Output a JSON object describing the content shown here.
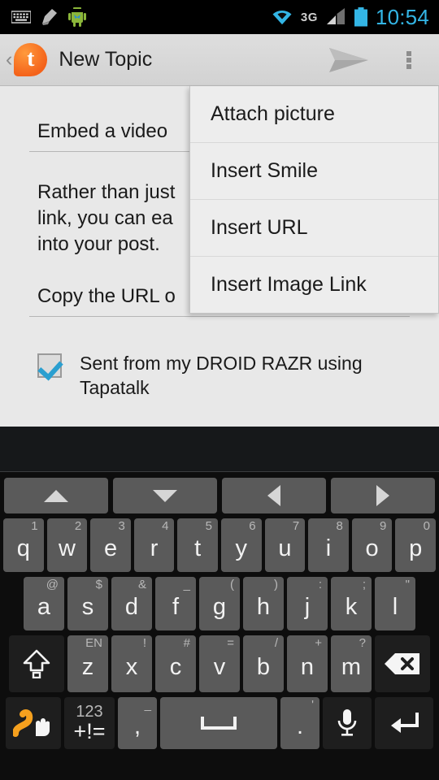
{
  "status_bar": {
    "icons": [
      "keyboard-icon",
      "broom-icon",
      "android-robot-icon"
    ],
    "wifi_icon": "wifi-icon",
    "network_label": "3G",
    "signal_icon": "signal-bars-icon",
    "battery_icon": "battery-icon",
    "clock": "10:54",
    "accent_color": "#33b5e5"
  },
  "action_bar": {
    "back_chevron": "‹",
    "logo_letter": "t",
    "logo_name": "tapatalk-logo-icon",
    "logo_color": "#f4621a",
    "title": "New Topic",
    "send_icon": "send-arrow-icon",
    "overflow_icon": "overflow-menu-icon"
  },
  "compose": {
    "title_value": "Embed a video",
    "body_lines": [
      "Rather than just",
      "link, you can ea",
      "into your post."
    ],
    "url_value": "Copy the URL o",
    "signature_label": "Sent from my DROID RAZR using Tapatalk",
    "signature_checked": true,
    "checkbox_color": "#2a9fd0"
  },
  "overflow_menu": {
    "items": [
      {
        "label": "Attach picture"
      },
      {
        "label": "Insert Smile"
      },
      {
        "label": "Insert URL"
      },
      {
        "label": "Insert Image Link"
      }
    ]
  },
  "keyboard": {
    "nav_keys": [
      {
        "name": "arrow-up-key",
        "icon": "triangle-up-icon"
      },
      {
        "name": "arrow-down-key",
        "icon": "triangle-down-icon"
      },
      {
        "name": "arrow-left-key",
        "icon": "triangle-left-icon"
      },
      {
        "name": "arrow-right-key",
        "icon": "triangle-right-icon"
      }
    ],
    "row1": [
      {
        "key": "q",
        "hint": "1"
      },
      {
        "key": "w",
        "hint": "2"
      },
      {
        "key": "e",
        "hint": "3"
      },
      {
        "key": "r",
        "hint": "4"
      },
      {
        "key": "t",
        "hint": "5"
      },
      {
        "key": "y",
        "hint": "6"
      },
      {
        "key": "u",
        "hint": "7"
      },
      {
        "key": "i",
        "hint": "8"
      },
      {
        "key": "o",
        "hint": "9"
      },
      {
        "key": "p",
        "hint": "0"
      }
    ],
    "row2": [
      {
        "key": "a",
        "hint": "@"
      },
      {
        "key": "s",
        "hint": "$"
      },
      {
        "key": "d",
        "hint": "&"
      },
      {
        "key": "f",
        "hint": "_"
      },
      {
        "key": "g",
        "hint": "("
      },
      {
        "key": "h",
        "hint": ")"
      },
      {
        "key": "j",
        "hint": ":"
      },
      {
        "key": "k",
        "hint": ";"
      },
      {
        "key": "l",
        "hint": "\""
      }
    ],
    "shift_key": {
      "name": "shift-key",
      "icon": "shift-arrow-icon"
    },
    "row3": [
      {
        "key": "z",
        "hint": "EN"
      },
      {
        "key": "x",
        "hint": "!"
      },
      {
        "key": "c",
        "hint": "#"
      },
      {
        "key": "v",
        "hint": "="
      },
      {
        "key": "b",
        "hint": "/"
      },
      {
        "key": "n",
        "hint": "+"
      },
      {
        "key": "m",
        "hint": "?"
      }
    ],
    "delete_key": {
      "name": "delete-key",
      "icon": "backspace-icon"
    },
    "row4": {
      "swype": {
        "name": "swype-gesture-key",
        "icon": "swype-trace-icon",
        "color": "#f5a01e"
      },
      "numeric": {
        "hint": "123",
        "label": "+!="
      },
      "comma": {
        "key": ",",
        "hint": "_"
      },
      "space": {
        "name": "space-key",
        "icon": "space-bar-icon"
      },
      "period": {
        "key": ".",
        "hint": "'"
      },
      "mic": {
        "name": "microphone-key",
        "icon": "microphone-icon"
      },
      "enter": {
        "name": "enter-key",
        "icon": "return-arrow-icon"
      }
    }
  }
}
